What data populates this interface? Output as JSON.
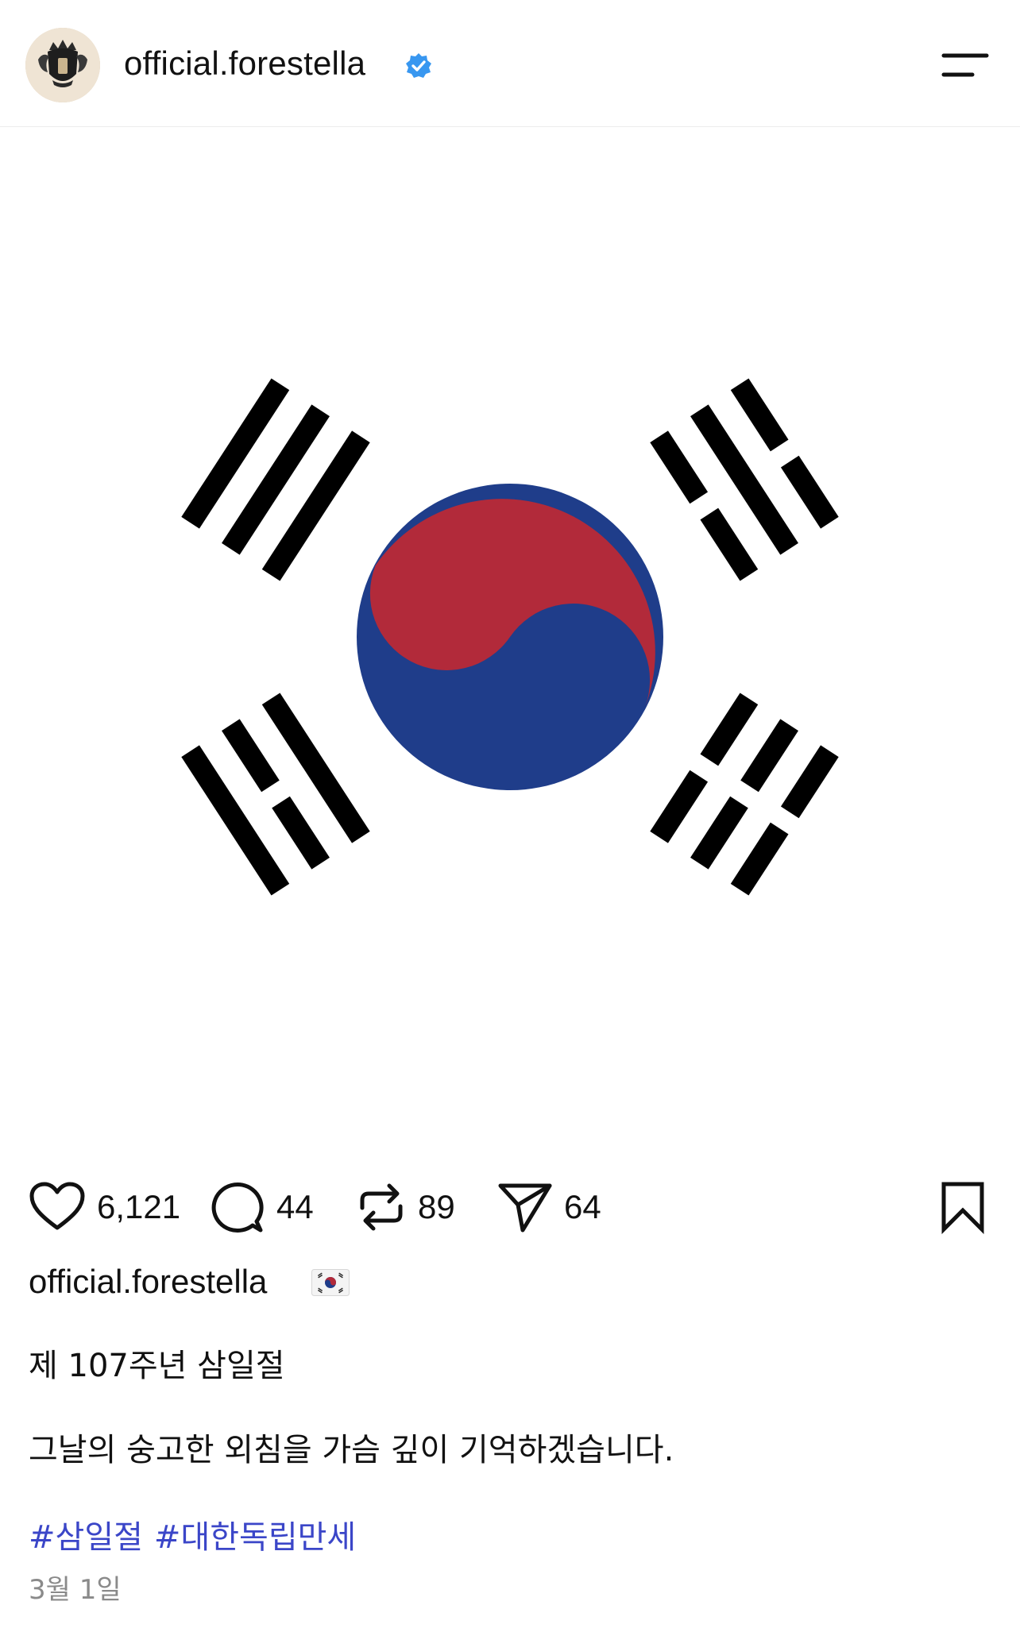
{
  "header": {
    "username": "official.forestella",
    "verified_color": "#3897f0",
    "menu_icon": "menu-icon"
  },
  "post": {
    "image_subject": "Taegukgi (flag of South Korea)",
    "colors": {
      "red": "#b22a3a",
      "blue": "#1f3d8a",
      "black": "#000000"
    }
  },
  "actions": {
    "likes": "6,121",
    "comments": "44",
    "reposts": "89",
    "shares": "64"
  },
  "caption": {
    "username": "official.forestella",
    "emoji": "🇰🇷",
    "line1": "제 107주년 삼일절",
    "line2": "그날의 숭고한 외침을 가슴 깊이 기억하겠습니다.",
    "hashtags": [
      "#삼일절",
      "#대한독립만세"
    ],
    "date": "3월 1일"
  },
  "accent_colors": {
    "hashtag": "#3b46c8",
    "date": "#8a8a8a"
  }
}
